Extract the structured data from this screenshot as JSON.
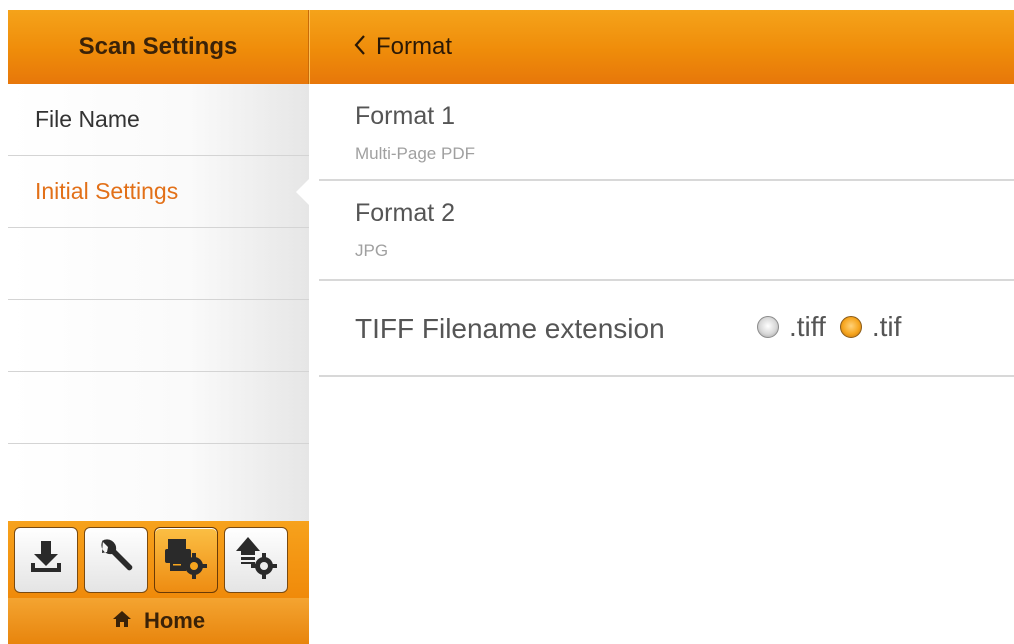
{
  "sidebar": {
    "title": "Scan Settings",
    "items": [
      {
        "label": "File Name",
        "active": false
      },
      {
        "label": "Initial Settings",
        "active": true
      },
      {
        "label": "",
        "active": false
      },
      {
        "label": "",
        "active": false
      },
      {
        "label": "",
        "active": false
      }
    ],
    "toolbar": [
      {
        "icon": "download-icon",
        "active": false
      },
      {
        "icon": "wrench-icon",
        "active": false
      },
      {
        "icon": "scanner-settings-icon",
        "active": true
      },
      {
        "icon": "upload-settings-icon",
        "active": false
      }
    ],
    "footer": {
      "icon": "home-icon",
      "label": "Home"
    }
  },
  "header": {
    "back_icon": "chevron-left-icon",
    "title": "Format"
  },
  "settings": {
    "format1": {
      "title": "Format 1",
      "value": "Multi-Page PDF"
    },
    "format2": {
      "title": "Format 2",
      "value": "JPG"
    },
    "tiff": {
      "label": "TIFF Filename extension",
      "options": [
        {
          "label": ".tiff",
          "selected": false
        },
        {
          "label": ".tif",
          "selected": true
        }
      ]
    }
  },
  "colors": {
    "header_orange": "#ef8c0a",
    "active_text": "#e27018",
    "radio_selected": "#f6a51e"
  }
}
